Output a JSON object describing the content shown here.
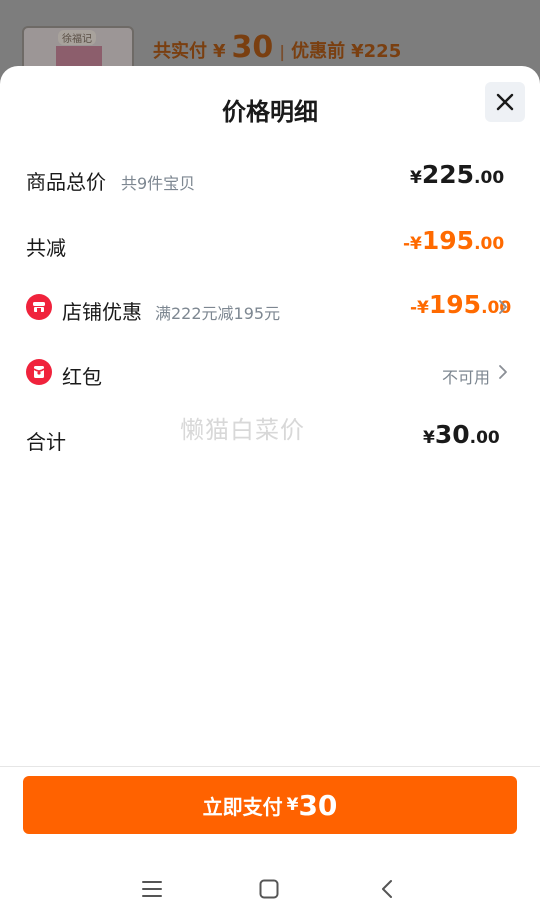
{
  "background": {
    "brand": "徐福记",
    "summary": {
      "paid_label": "共实付",
      "paid_currency": "¥",
      "paid_amount": "30",
      "separator": "|",
      "before_label": "优惠前",
      "before_amount": "¥225"
    }
  },
  "sheet": {
    "title": "价格明细",
    "rows": [
      {
        "label": "商品总价",
        "sub": "共9件宝贝",
        "currency": "¥",
        "int": "225",
        "dec": ".00"
      },
      {
        "label": "共减",
        "currency": "-¥",
        "int": "195",
        "dec": ".00"
      },
      {
        "label": "店铺优惠",
        "sub": "满222元减195元",
        "currency": "-¥",
        "int": "195",
        "dec": ".00"
      },
      {
        "label": "红包",
        "status": "不可用"
      },
      {
        "label": "合计",
        "currency": "¥",
        "int": "30",
        "dec": ".00"
      }
    ],
    "watermark": "懒猫白菜价"
  },
  "pay_button": {
    "label": "立即支付",
    "currency": "¥",
    "amount": "30"
  },
  "icons": {
    "close": "close-icon",
    "shop": "shop-discount-icon",
    "red_packet": "red-packet-icon",
    "chevron": "chevron-right-icon"
  },
  "colors": {
    "accent": "#ff6200",
    "discount": "#ff6a00",
    "icon_red": "#f0233c"
  },
  "nav": [
    "menu-icon",
    "home-icon",
    "back-icon"
  ]
}
